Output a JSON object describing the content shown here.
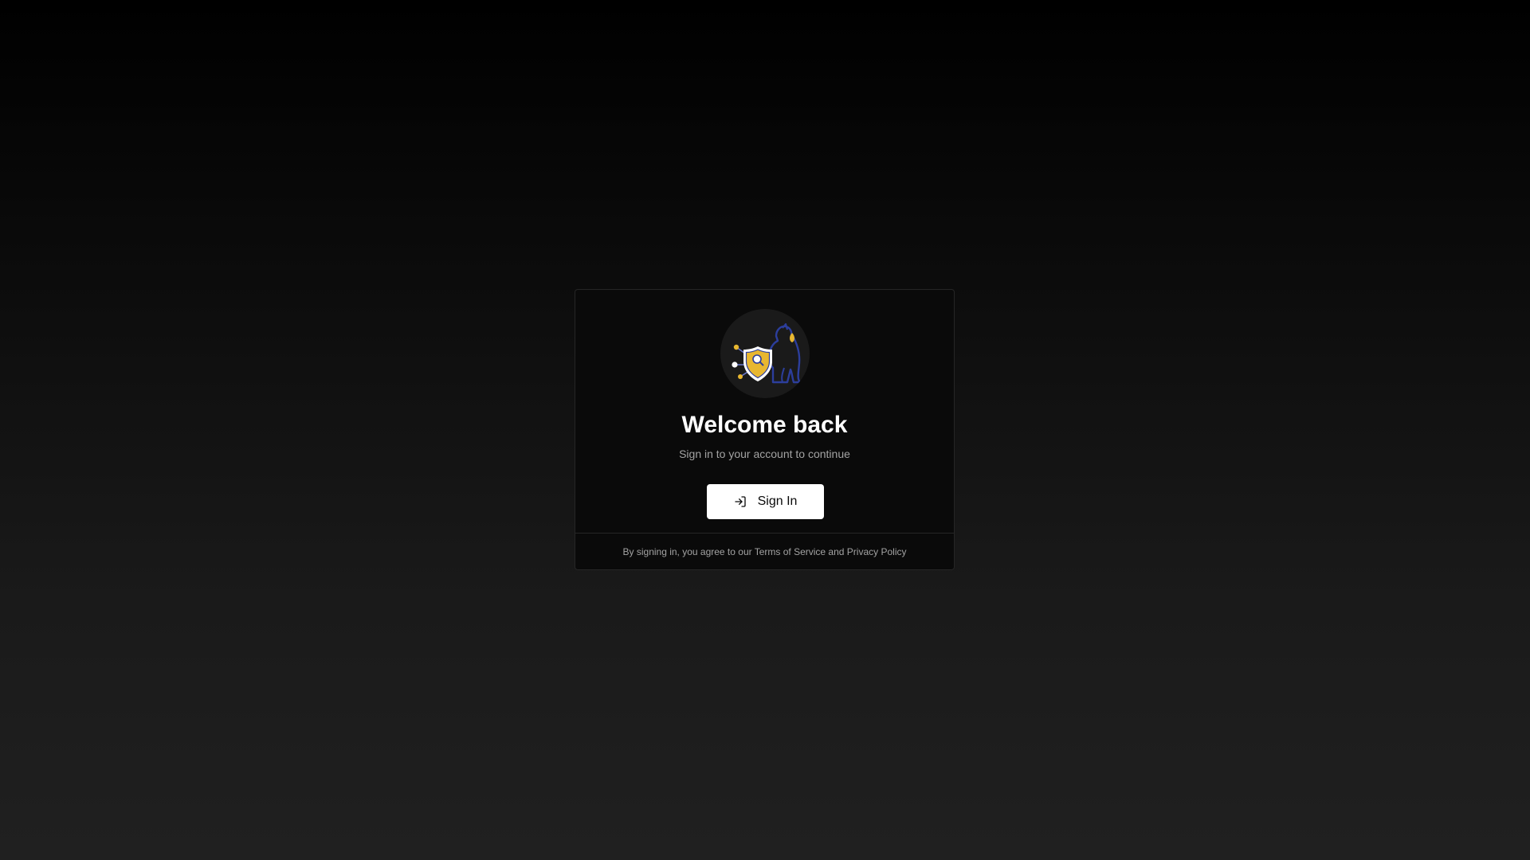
{
  "login": {
    "logo_icon": "shield-dog-logo-icon",
    "title": "Welcome back",
    "subtitle": "Sign in to your account to continue",
    "signin_icon": "log-in-icon",
    "signin_label": "Sign In",
    "footer_prefix": "By signing in, you agree to our ",
    "terms_label": "Terms of Service",
    "footer_and": " and ",
    "privacy_label": "Privacy Policy"
  },
  "colors": {
    "background_top": "#000000",
    "background_bottom": "#202020",
    "card_background": "#0a0a0a",
    "card_border": "#262626",
    "button_background": "#ffffff",
    "logo_shield": "#e8b730",
    "logo_dog_outline": "#2c3e9c"
  }
}
